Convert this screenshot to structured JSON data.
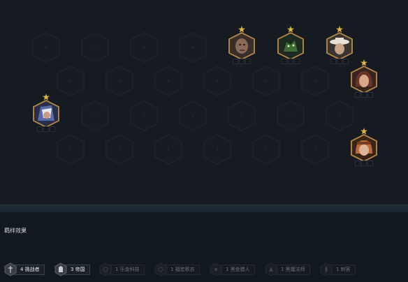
{
  "bonds": {
    "title": "羁绊效果",
    "traits": [
      {
        "label": "4 挑战者",
        "state": "active",
        "icon": "challenger-icon"
      },
      {
        "label": "3 帝国",
        "state": "active",
        "icon": "empire-icon"
      },
      {
        "label": "1 乐金科技",
        "state": "inactive",
        "icon": "tech-icon"
      },
      {
        "label": "1 福宏歌衣",
        "state": "inactive",
        "icon": "gear-icon"
      },
      {
        "label": "1 黑金猎人",
        "state": "inactive",
        "icon": "hunter-icon"
      },
      {
        "label": "1 黑魔法师",
        "state": "inactive",
        "icon": "mage-icon"
      },
      {
        "label": "1 刺客",
        "state": "inactive",
        "icon": "assassin-icon"
      }
    ]
  },
  "units": [
    {
      "name": "bald-fighter",
      "stars": 1,
      "tone": "#8a6a58"
    },
    {
      "name": "green-beast",
      "stars": 1,
      "tone": "#3f6b3a"
    },
    {
      "name": "white-hat-gunner",
      "stars": 1,
      "tone": "#cfc6b4"
    },
    {
      "name": "brunette-heroine",
      "stars": 1,
      "tone": "#8a4a3a"
    },
    {
      "name": "hooded-assassin",
      "stars": 1,
      "tone": "#5a6aa8"
    },
    {
      "name": "red-hair-gunner",
      "stars": 1,
      "tone": "#b86a3a"
    }
  ],
  "colors": {
    "star": "#e0b64a",
    "hex_border_unit": "#b98b4a",
    "hex_slot_border": "#1f252d"
  }
}
